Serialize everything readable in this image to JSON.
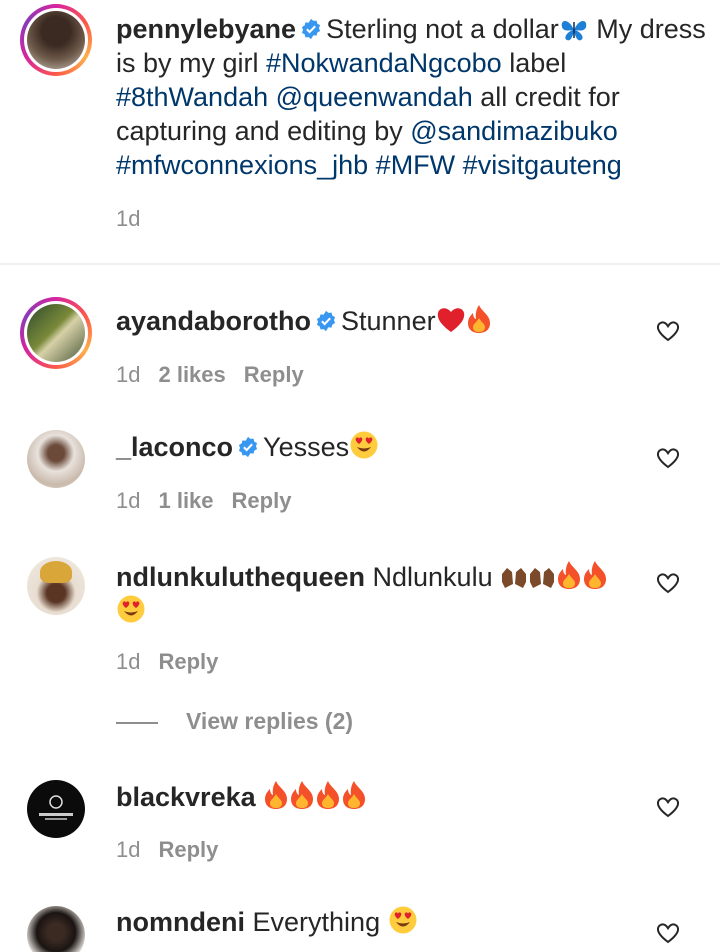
{
  "post": {
    "username": "pennylebyane",
    "caption_parts": [
      {
        "text": "Sterling not a dollar",
        "type": "text"
      },
      {
        "text": "My dress is by my girl",
        "type": "text"
      },
      {
        "text": "#NokwandaNgcobo",
        "type": "tag"
      },
      {
        "text": "label",
        "type": "text"
      },
      {
        "text": "#8thWandah",
        "type": "tag"
      },
      {
        "text": "@queenwandah",
        "type": "tag"
      },
      {
        "text": "all credit for capturing and editing by",
        "type": "text"
      },
      {
        "text": "@sandimazibuko",
        "type": "tag"
      },
      {
        "text": "#mfwconnexions_jhb",
        "type": "tag"
      },
      {
        "text": "#MFW",
        "type": "tag"
      },
      {
        "text": "#visitgauteng",
        "type": "tag"
      }
    ],
    "time": "1d"
  },
  "comments": [
    {
      "username": "ayandaborotho",
      "text": "Stunner",
      "time": "1d",
      "likes": "2 likes",
      "reply": "Reply"
    },
    {
      "username": "_laconco",
      "text": "Yesses",
      "time": "1d",
      "likes": "1 like",
      "reply": "Reply"
    },
    {
      "username": "ndlunkuluthequeen",
      "text": "Ndlunkulu",
      "time": "1d",
      "reply": "Reply"
    },
    {
      "username": "blackvreka",
      "text": "",
      "time": "1d",
      "reply": "Reply"
    },
    {
      "username": "nomndeni",
      "text": "Everything",
      "time": "",
      "reply": ""
    }
  ],
  "view_replies": "View replies (2)",
  "colors": {
    "text": "#262626",
    "link": "#00376b",
    "meta": "#8e8e8e",
    "verified": "#3897f0",
    "divider": "#efefef"
  }
}
